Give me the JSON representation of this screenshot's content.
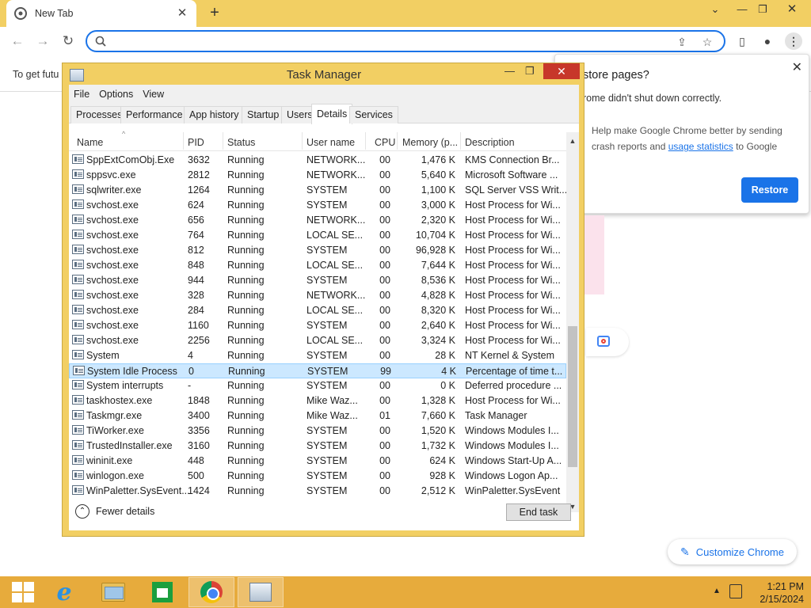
{
  "chrome": {
    "tab_title": "New Tab",
    "omnibox_value": "",
    "infobar_text": "To get futu"
  },
  "restore": {
    "title": "store pages?",
    "body": "rome didn't shut down correctly.",
    "help_prefix": "Help make Google Chrome better by sending crash reports and ",
    "help_link": "usage statistics",
    "help_suffix": " to Google",
    "button": "Restore"
  },
  "customize": {
    "label": "Customize Chrome"
  },
  "taskmanager": {
    "title": "Task Manager",
    "menu": [
      "File",
      "Options",
      "View"
    ],
    "tabs": [
      "Processes",
      "Performance",
      "App history",
      "Startup",
      "Users",
      "Details",
      "Services"
    ],
    "active_tab": "Details",
    "columns": [
      "Name",
      "PID",
      "Status",
      "User name",
      "CPU",
      "Memory (p...",
      "Description"
    ],
    "rows": [
      {
        "name": "SppExtComObj.Exe",
        "pid": "3632",
        "status": "Running",
        "user": "NETWORK...",
        "cpu": "00",
        "mem": "1,476 K",
        "desc": "KMS Connection Br..."
      },
      {
        "name": "sppsvc.exe",
        "pid": "2812",
        "status": "Running",
        "user": "NETWORK...",
        "cpu": "00",
        "mem": "5,640 K",
        "desc": "Microsoft Software ..."
      },
      {
        "name": "sqlwriter.exe",
        "pid": "1264",
        "status": "Running",
        "user": "SYSTEM",
        "cpu": "00",
        "mem": "1,100 K",
        "desc": "SQL Server VSS Writ..."
      },
      {
        "name": "svchost.exe",
        "pid": "624",
        "status": "Running",
        "user": "SYSTEM",
        "cpu": "00",
        "mem": "3,000 K",
        "desc": "Host Process for Wi..."
      },
      {
        "name": "svchost.exe",
        "pid": "656",
        "status": "Running",
        "user": "NETWORK...",
        "cpu": "00",
        "mem": "2,320 K",
        "desc": "Host Process for Wi..."
      },
      {
        "name": "svchost.exe",
        "pid": "764",
        "status": "Running",
        "user": "LOCAL SE...",
        "cpu": "00",
        "mem": "10,704 K",
        "desc": "Host Process for Wi..."
      },
      {
        "name": "svchost.exe",
        "pid": "812",
        "status": "Running",
        "user": "SYSTEM",
        "cpu": "00",
        "mem": "96,928 K",
        "desc": "Host Process for Wi..."
      },
      {
        "name": "svchost.exe",
        "pid": "848",
        "status": "Running",
        "user": "LOCAL SE...",
        "cpu": "00",
        "mem": "7,644 K",
        "desc": "Host Process for Wi..."
      },
      {
        "name": "svchost.exe",
        "pid": "944",
        "status": "Running",
        "user": "SYSTEM",
        "cpu": "00",
        "mem": "8,536 K",
        "desc": "Host Process for Wi..."
      },
      {
        "name": "svchost.exe",
        "pid": "328",
        "status": "Running",
        "user": "NETWORK...",
        "cpu": "00",
        "mem": "4,828 K",
        "desc": "Host Process for Wi..."
      },
      {
        "name": "svchost.exe",
        "pid": "284",
        "status": "Running",
        "user": "LOCAL SE...",
        "cpu": "00",
        "mem": "8,320 K",
        "desc": "Host Process for Wi..."
      },
      {
        "name": "svchost.exe",
        "pid": "1160",
        "status": "Running",
        "user": "SYSTEM",
        "cpu": "00",
        "mem": "2,640 K",
        "desc": "Host Process for Wi..."
      },
      {
        "name": "svchost.exe",
        "pid": "2256",
        "status": "Running",
        "user": "LOCAL SE...",
        "cpu": "00",
        "mem": "3,324 K",
        "desc": "Host Process for Wi..."
      },
      {
        "name": "System",
        "pid": "4",
        "status": "Running",
        "user": "SYSTEM",
        "cpu": "00",
        "mem": "28 K",
        "desc": "NT Kernel & System"
      },
      {
        "name": "System Idle Process",
        "pid": "0",
        "status": "Running",
        "user": "SYSTEM",
        "cpu": "99",
        "mem": "4 K",
        "desc": "Percentage of time t...",
        "selected": true
      },
      {
        "name": "System interrupts",
        "pid": "-",
        "status": "Running",
        "user": "SYSTEM",
        "cpu": "00",
        "mem": "0 K",
        "desc": "Deferred procedure ..."
      },
      {
        "name": "taskhostex.exe",
        "pid": "1848",
        "status": "Running",
        "user": "Mike Waz...",
        "cpu": "00",
        "mem": "1,328 K",
        "desc": "Host Process for Wi..."
      },
      {
        "name": "Taskmgr.exe",
        "pid": "3400",
        "status": "Running",
        "user": "Mike Waz...",
        "cpu": "01",
        "mem": "7,660 K",
        "desc": "Task Manager"
      },
      {
        "name": "TiWorker.exe",
        "pid": "3356",
        "status": "Running",
        "user": "SYSTEM",
        "cpu": "00",
        "mem": "1,520 K",
        "desc": "Windows Modules I..."
      },
      {
        "name": "TrustedInstaller.exe",
        "pid": "3160",
        "status": "Running",
        "user": "SYSTEM",
        "cpu": "00",
        "mem": "1,732 K",
        "desc": "Windows Modules I..."
      },
      {
        "name": "wininit.exe",
        "pid": "448",
        "status": "Running",
        "user": "SYSTEM",
        "cpu": "00",
        "mem": "624 K",
        "desc": "Windows Start-Up A..."
      },
      {
        "name": "winlogon.exe",
        "pid": "500",
        "status": "Running",
        "user": "SYSTEM",
        "cpu": "00",
        "mem": "928 K",
        "desc": "Windows Logon Ap..."
      },
      {
        "name": "WinPaletter.SysEvent...",
        "pid": "1424",
        "status": "Running",
        "user": "SYSTEM",
        "cpu": "00",
        "mem": "2,512 K",
        "desc": "WinPaletter.SysEvent"
      }
    ],
    "fewer_details": "Fewer details",
    "end_task": "End task"
  },
  "taskbar": {
    "time": "1:21 PM",
    "date": "2/15/2024"
  },
  "colors": {
    "chrome_frame": "#f2cf63",
    "taskbar": "#e7ab3c",
    "accent": "#1a73e8",
    "close_red": "#c7372a",
    "selection": "#cce8ff"
  }
}
